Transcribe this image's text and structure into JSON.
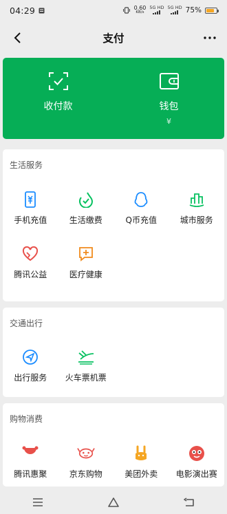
{
  "status_bar": {
    "time": "04:29",
    "net_speed_value": "0.60",
    "net_speed_unit": "KB/s",
    "signal_1": "5G HD",
    "signal_2": "5G HD",
    "battery": "75%",
    "battery_level": 0.75
  },
  "header": {
    "title": "支付"
  },
  "pay_card": {
    "color": "#06ae56",
    "items": [
      {
        "label": "收付款",
        "sub": "",
        "icon": "scan-pay-icon"
      },
      {
        "label": "钱包",
        "sub": "¥",
        "icon": "wallet-icon"
      }
    ]
  },
  "sections": [
    {
      "title": "生活服务",
      "items": [
        {
          "label": "手机充值",
          "icon": "phone-recharge-icon",
          "color": "#1a8cff"
        },
        {
          "label": "生活缴费",
          "icon": "utility-payment-icon",
          "color": "#07c160"
        },
        {
          "label": "Q币充值",
          "icon": "qq-coin-icon",
          "color": "#1a8cff"
        },
        {
          "label": "城市服务",
          "icon": "city-service-icon",
          "color": "#07c160"
        },
        {
          "label": "腾讯公益",
          "icon": "charity-heart-icon",
          "color": "#e8504a"
        },
        {
          "label": "医疗健康",
          "icon": "medical-health-icon",
          "color": "#f08a1c"
        }
      ]
    },
    {
      "title": "交通出行",
      "items": [
        {
          "label": "出行服务",
          "icon": "travel-service-icon",
          "color": "#1a8cff"
        },
        {
          "label": "火车票机票",
          "icon": "train-plane-icon",
          "color": "#07c160"
        }
      ]
    },
    {
      "title": "购物消费",
      "items": [
        {
          "label": "腾讯惠聚",
          "icon": "tencent-huiju-icon",
          "color": "#e8504a"
        },
        {
          "label": "京东购物",
          "icon": "jd-shopping-icon",
          "color": "#e8504a"
        },
        {
          "label": "美团外卖",
          "icon": "meituan-delivery-icon",
          "color": "#f5a623"
        },
        {
          "label": "电影演出赛",
          "icon": "movie-show-icon",
          "color": "#e8504a"
        }
      ]
    }
  ]
}
